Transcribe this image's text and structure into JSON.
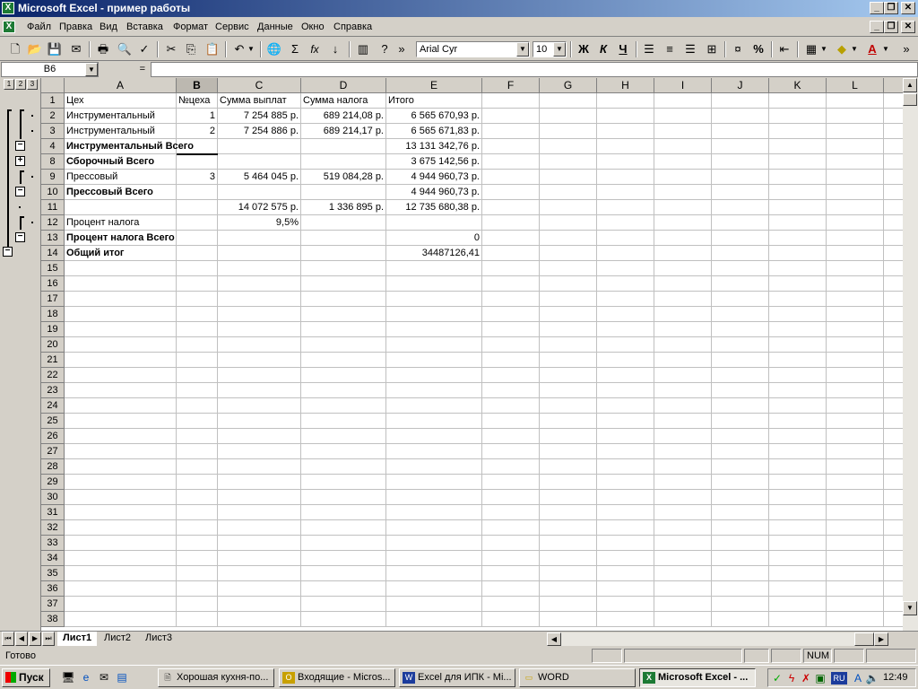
{
  "window": {
    "title": "Microsoft Excel - пример работы"
  },
  "menu": [
    "Файл",
    "Правка",
    "Вид",
    "Вставка",
    "Формат",
    "Сервис",
    "Данные",
    "Окно",
    "Справка"
  ],
  "toolbar": {
    "font_name": "Arial Cyr",
    "font_size": "10",
    "bold": "Ж",
    "italic": "К",
    "underline": "Ч"
  },
  "formula_bar": {
    "name_box": "B6",
    "equals": "=",
    "content": ""
  },
  "outline_levels": [
    "1",
    "2",
    "3"
  ],
  "columns": [
    "A",
    "B",
    "C",
    "D",
    "E",
    "F",
    "G",
    "H",
    "I",
    "J",
    "K",
    "L"
  ],
  "rows": [
    {
      "n": "1",
      "A": "Цех",
      "B": "№цеха",
      "C": "Сумма выплат",
      "D": "Сумма налога",
      "E": "Итого"
    },
    {
      "n": "2",
      "A": "Инструментальный",
      "B": "1",
      "C": "7 254 885 р.",
      "D": "689 214,08 р.",
      "E": "6 565 670,93 р."
    },
    {
      "n": "3",
      "A": "Инструментальный",
      "B": "2",
      "C": "7 254 886 р.",
      "D": "689 214,17 р.",
      "E": "6 565 671,83 р."
    },
    {
      "n": "4",
      "A": "Инструментальный Всего",
      "B": "",
      "C": "",
      "D": "",
      "E": "13 131 342,76 р.",
      "bold": true
    },
    {
      "n": "8",
      "A": "Сборочный Всего",
      "B": "",
      "C": "",
      "D": "",
      "E": "3 675 142,56 р.",
      "bold": true
    },
    {
      "n": "9",
      "A": "Прессовый",
      "B": "3",
      "C": "5 464 045 р.",
      "D": "519 084,28 р.",
      "E": "4 944 960,73 р."
    },
    {
      "n": "10",
      "A": "Прессовый Всего",
      "B": "",
      "C": "",
      "D": "",
      "E": "4 944 960,73 р.",
      "bold": true
    },
    {
      "n": "11",
      "A": "",
      "B": "",
      "C": "14 072 575 р.",
      "D": "1 336 895 р.",
      "E": "12 735 680,38 р."
    },
    {
      "n": "12",
      "A": "Процент налога",
      "B": "",
      "C": "9,5%",
      "D": "",
      "E": ""
    },
    {
      "n": "13",
      "A": "Процент налога Всего",
      "B": "",
      "C": "",
      "D": "",
      "E": "0",
      "bold": true
    },
    {
      "n": "14",
      "A": "Общий итог",
      "B": "",
      "C": "",
      "D": "",
      "E": "34487126,41",
      "bold": true
    },
    {
      "n": "15"
    },
    {
      "n": "16"
    },
    {
      "n": "17"
    },
    {
      "n": "18"
    },
    {
      "n": "19"
    },
    {
      "n": "20"
    },
    {
      "n": "21"
    },
    {
      "n": "22"
    },
    {
      "n": "23"
    },
    {
      "n": "24"
    },
    {
      "n": "25"
    },
    {
      "n": "26"
    },
    {
      "n": "27"
    },
    {
      "n": "28"
    },
    {
      "n": "29"
    },
    {
      "n": "30"
    },
    {
      "n": "31"
    },
    {
      "n": "32"
    },
    {
      "n": "33"
    },
    {
      "n": "34"
    },
    {
      "n": "35"
    },
    {
      "n": "36"
    },
    {
      "n": "37"
    },
    {
      "n": "38"
    }
  ],
  "sheets": [
    "Лист1",
    "Лист2",
    "Лист3"
  ],
  "status": {
    "ready": "Готово",
    "num": "NUM"
  },
  "taskbar": {
    "start": "Пуск",
    "tasks": [
      "Хорошая кухня-по...",
      "Входящие - Micros...",
      "Excel для ИПК - Mi...",
      "WORD",
      "Microsoft Excel - ..."
    ],
    "lang": "RU",
    "clock": "12:49"
  }
}
